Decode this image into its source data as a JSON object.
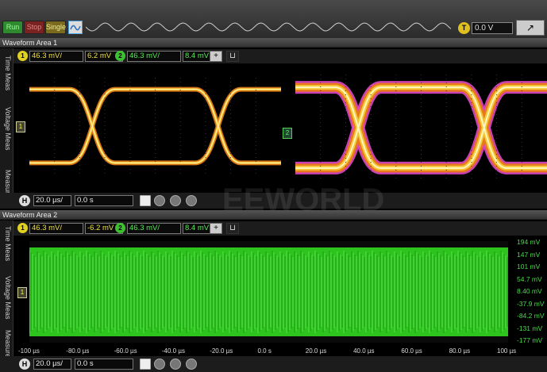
{
  "toolbar": {
    "run_label": "Run",
    "stop_label": "Stop",
    "single_label": "Single",
    "trigger_badge": "T",
    "trigger_level": "0.0 V"
  },
  "area1": {
    "title": "Waveform Area 1",
    "tabs": [
      "Time Meas",
      "Voltage Meas",
      "Measure"
    ],
    "ch1": {
      "badge": "1",
      "scale": "46.3 mV/",
      "offset": "6.2 mV"
    },
    "ch2": {
      "badge": "2",
      "scale": "46.3 mV/",
      "offset": "8.4 mV"
    },
    "add_label": "+",
    "horizontal": {
      "badge": "H",
      "scale": "20.0 µs/",
      "position": "0.0 s"
    }
  },
  "area2": {
    "title": "Waveform Area 2",
    "tabs": [
      "Time Meas",
      "Voltage Meas",
      "Measure"
    ],
    "ch1": {
      "badge": "1",
      "scale": "46.3 mV/",
      "offset": "-6.2 mV"
    },
    "ch2": {
      "badge": "2",
      "scale": "46.3 mV/",
      "offset": "8.4 mV"
    },
    "add_label": "+",
    "horizontal": {
      "badge": "H",
      "scale": "20.0 µs/",
      "position": "0.0 s"
    }
  },
  "chart_data": {
    "type": "area",
    "x_ticks": [
      "-100 µs",
      "-80.0 µs",
      "-60.0 µs",
      "-40.0 µs",
      "-20.0 µs",
      "0.0 s",
      "20.0 µs",
      "40.0 µs",
      "60.0 µs",
      "80.0 µs",
      "100 µs"
    ],
    "y_ticks": [
      "194 mV",
      "147 mV",
      "101 mV",
      "54.7 mV",
      "8.40 mV",
      "-37.9 mV",
      "-84.2 mV",
      "-131 mV",
      "-177 mV"
    ],
    "xlim": [
      -100,
      100
    ],
    "ylim": [
      -177,
      194
    ]
  },
  "colors": {
    "wave_green": "#2ec41e",
    "eye_yellow": "#f4c83a",
    "eye_orange": "#e87a1a",
    "eye_magenta": "#e048c8"
  },
  "watermark": "EEWORLD"
}
